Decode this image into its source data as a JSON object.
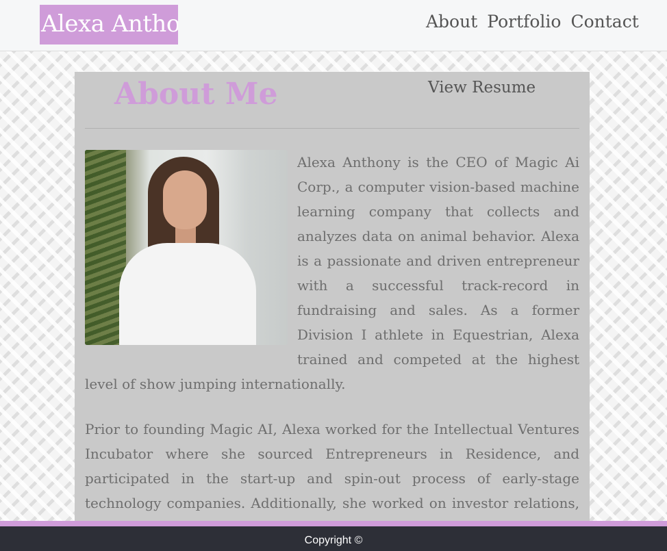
{
  "colors": {
    "accent": "#cf9cd9"
  },
  "header": {
    "brand": "Alexa Anthony",
    "nav": [
      {
        "label": "About",
        "icon": ""
      },
      {
        "label": "Portfolio",
        "icon": ""
      },
      {
        "label": "Contact",
        "icon": ""
      }
    ]
  },
  "about": {
    "title": "About Me",
    "resume_link": "View Resume",
    "photo_icon": "portrait-photo",
    "paragraphs": [
      "Alexa Anthony is the CEO of Magic Ai Corp., a computer vision-based machine learning company that collects and analyzes data on animal behavior. Alexa is a passionate and driven entrepreneur with a successful track-record in fundraising and sales. As a former Division I athlete in Equestrian, Alexa trained and competed at the highest level of show jumping internationally.",
      "Prior to founding Magic AI, Alexa worked for the Intellectual Ventures Incubator where she sourced Entrepreneurs in Residence, and participated in the start-up and spin-out process of early-stage technology companies. Additionally, she worked on investor relations, corporate development projects, and licensing transactions."
    ]
  },
  "footer": {
    "copyright": "Copyright ©"
  }
}
